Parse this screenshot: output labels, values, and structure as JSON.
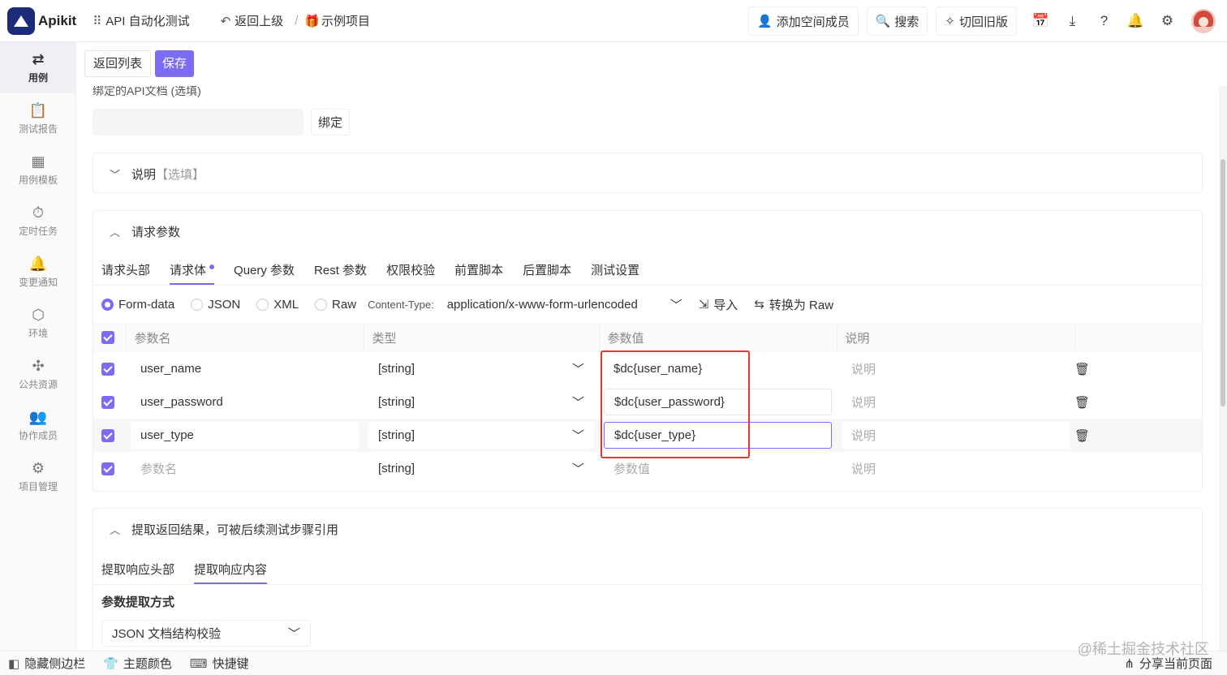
{
  "app": {
    "name": "Apikit",
    "project_name": "API 自动化测试",
    "back_up_label": "返回上级",
    "breadcrumb_sep": "/",
    "breadcrumb_current": "示例项目"
  },
  "topbar": {
    "add_member": "添加空间成员",
    "search": "搜索",
    "switch_old": "切回旧版"
  },
  "sidebar": {
    "items": [
      {
        "label": "用例",
        "icon": "cases-icon"
      },
      {
        "label": "测试报告",
        "icon": "report-icon"
      },
      {
        "label": "用例模板",
        "icon": "template-icon"
      },
      {
        "label": "定时任务",
        "icon": "timer-icon"
      },
      {
        "label": "变更通知",
        "icon": "bell-icon"
      },
      {
        "label": "环境",
        "icon": "cube-icon"
      },
      {
        "label": "公共资源",
        "icon": "puzzle-icon"
      },
      {
        "label": "协作成员",
        "icon": "users-icon"
      },
      {
        "label": "项目管理",
        "icon": "gear-icon"
      }
    ]
  },
  "subbar": {
    "back_list": "返回列表",
    "save": "保存"
  },
  "bind_doc": {
    "label": "绑定的API文档 (选填)",
    "input_value": "",
    "button": "绑定"
  },
  "description": {
    "title": "说明",
    "optional": "【选填】"
  },
  "request_params": {
    "title": "请求参数",
    "tabs": [
      "请求头部",
      "请求体",
      "Query 参数",
      "Rest 参数",
      "权限校验",
      "前置脚本",
      "后置脚本",
      "测试设置"
    ],
    "active_tab": "请求体",
    "body_types": [
      "Form-data",
      "JSON",
      "XML",
      "Raw"
    ],
    "selected_body_type": "Form-data",
    "content_type_label": "Content-Type:",
    "content_type_value": "application/x-www-form-urlencoded",
    "import_label": "导入",
    "convert_label": "转换为 Raw",
    "columns": [
      "参数名",
      "类型",
      "参数值",
      "说明"
    ],
    "rows": [
      {
        "name": "user_name",
        "type": "[string]",
        "value": "$dc{user_name}",
        "desc_placeholder": "说明"
      },
      {
        "name": "user_password",
        "type": "[string]",
        "value": "$dc{user_password}",
        "desc_placeholder": "说明"
      },
      {
        "name": "user_type",
        "type": "[string]",
        "value": "$dc{user_type}",
        "desc_placeholder": "说明"
      }
    ],
    "new_row": {
      "name_placeholder": "参数名",
      "type": "[string]",
      "value_placeholder": "参数值",
      "desc_placeholder": "说明"
    }
  },
  "extract": {
    "title": "提取返回结果，可被后续测试步骤引用",
    "tabs": [
      "提取响应头部",
      "提取响应内容"
    ],
    "active_tab": "提取响应内容",
    "method_label": "参数提取方式",
    "method_value": "JSON 文档结构校验"
  },
  "bottombar": {
    "hide_sidebar": "隐藏侧边栏",
    "theme": "主题颜色",
    "shortcuts": "快捷键",
    "share": "分享当前页面"
  },
  "watermark": "@稀土掘金技术社区",
  "colors": {
    "accent": "#7b6cf6",
    "highlight_box": "#ee3333",
    "logo": "#1c2a7a"
  }
}
